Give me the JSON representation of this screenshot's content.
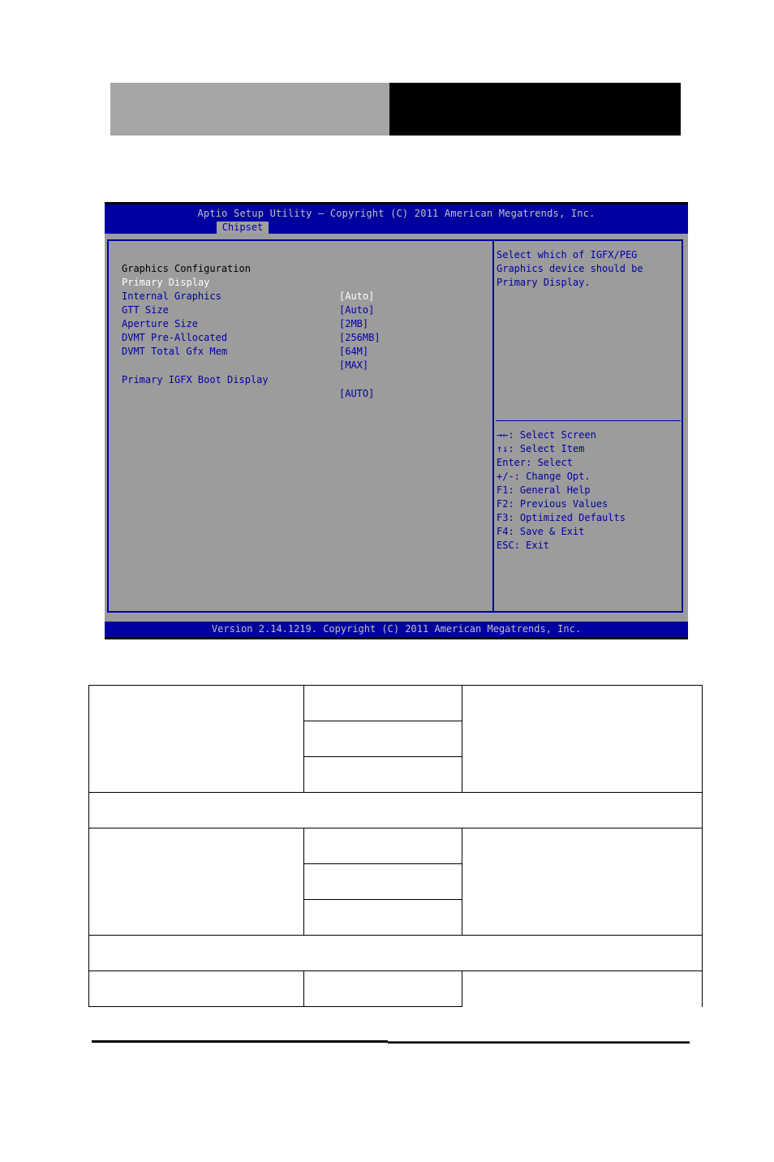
{
  "bios": {
    "title": "Aptio Setup Utility – Copyright (C) 2011 American Megatrends, Inc.",
    "active_tab": "Chipset",
    "footer": "Version 2.14.1219. Copyright (C) 2011 American Megatrends, Inc.",
    "section_title": "Graphics Configuration",
    "items": [
      {
        "label": "Primary Display",
        "value": "[Auto]",
        "selected": true
      },
      {
        "label": "Internal Graphics",
        "value": "[Auto]"
      },
      {
        "label": "GTT Size",
        "value": "[2MB]"
      },
      {
        "label": "Aperture Size",
        "value": "[256MB]"
      },
      {
        "label": "DVMT Pre-Allocated",
        "value": "[64M]"
      },
      {
        "label": "DVMT Total Gfx Mem",
        "value": "[MAX]"
      },
      {
        "label": "Primary IGFX Boot Display",
        "value": "[AUTO]"
      }
    ],
    "help_text": [
      "Select which of IGFX/PEG",
      "Graphics device should be",
      "Primary Display."
    ],
    "key_help": [
      "→←: Select Screen",
      "↑↓: Select Item",
      "Enter: Select",
      "+/-: Change Opt.",
      "F1: General Help",
      "F2: Previous Values",
      "F3: Optimized Defaults",
      "F4: Save & Exit",
      "ESC: Exit"
    ],
    "colors": {
      "blue": "#0000a0",
      "gray": "#9c9c9c",
      "highlight": "#ffffff"
    }
  }
}
